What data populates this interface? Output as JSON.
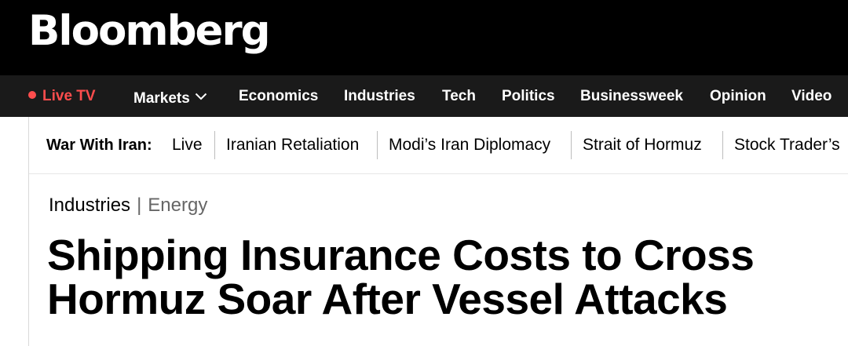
{
  "header": {
    "logo": "Bloomberg"
  },
  "nav": {
    "live_tv": "Live TV",
    "items": [
      "Markets",
      "Economics",
      "Industries",
      "Tech",
      "Politics",
      "Businessweek",
      "Opinion",
      "Video"
    ],
    "live_color": "#ff4d4d"
  },
  "topics": {
    "label": "War With Iran:",
    "links": [
      "Live",
      "Iranian Retaliation",
      "Modi’s Iran Diplomacy",
      "Strait of Hormuz",
      "Stock Trader’s"
    ]
  },
  "article": {
    "category": "Industries",
    "subcategory": "Energy",
    "headline": "Shipping Insurance Costs to Cross Hormuz Soar After Vessel Attacks"
  }
}
